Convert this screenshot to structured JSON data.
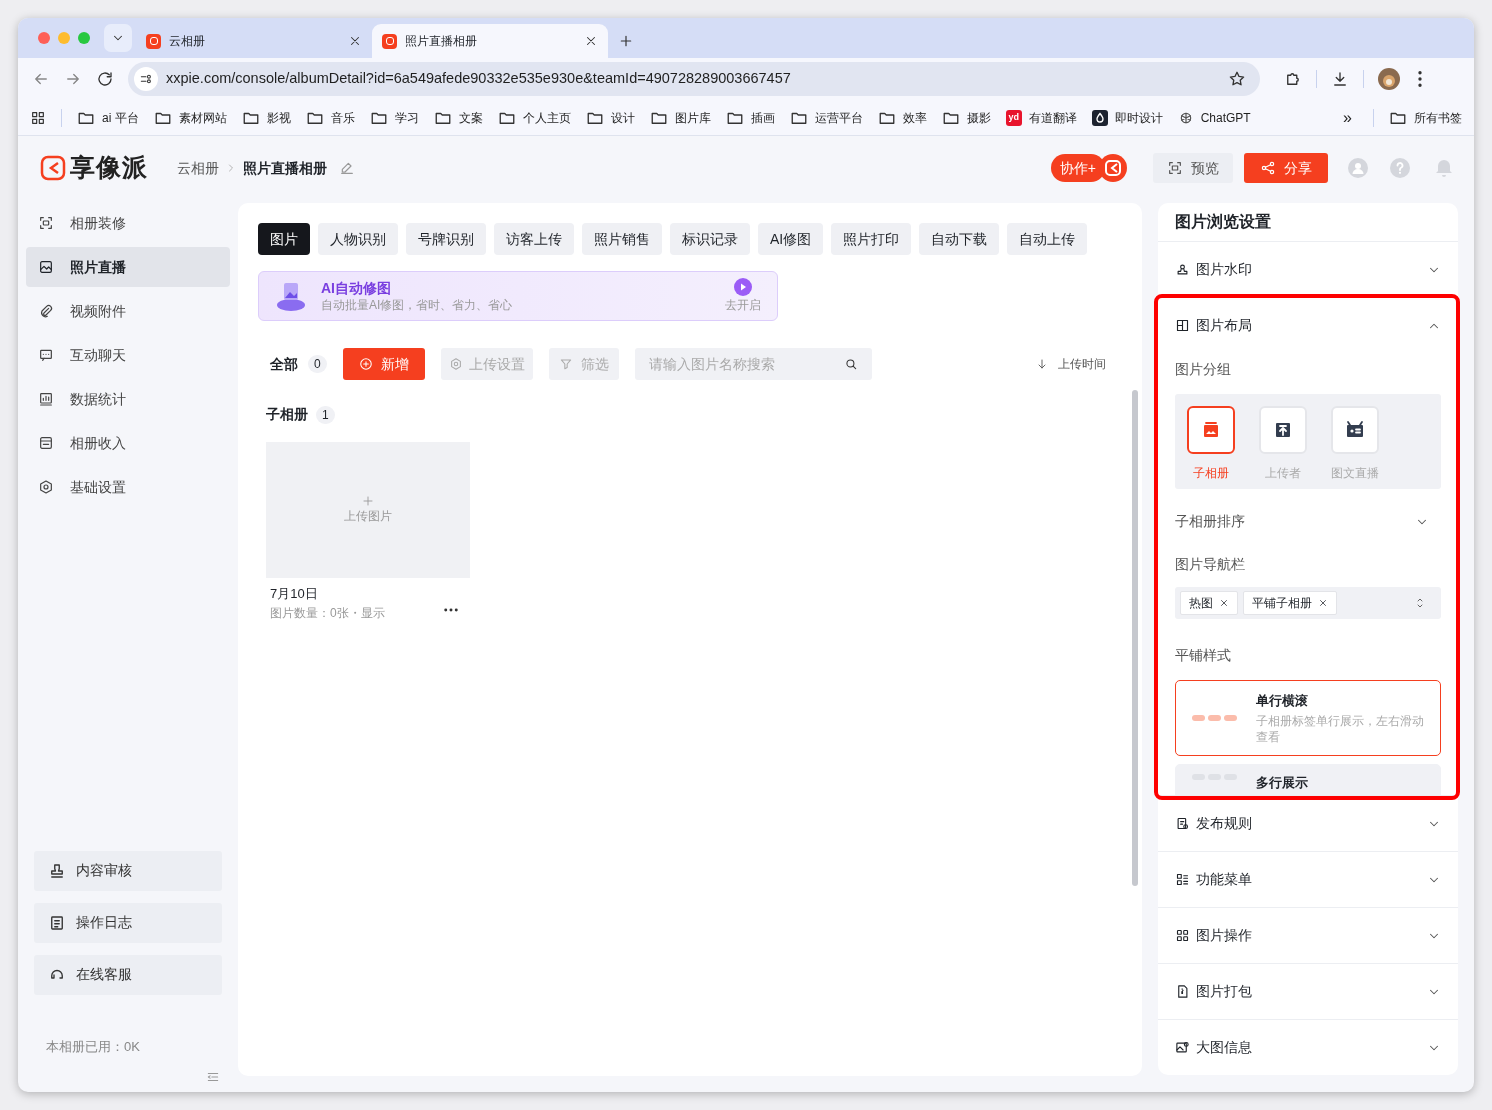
{
  "browser": {
    "tabs": [
      {
        "title": "云相册",
        "selected": false
      },
      {
        "title": "照片直播相册",
        "selected": true
      }
    ],
    "url": "xxpie.com/console/albumDetail?id=6a549afede90332e535e930e&teamId=490728289003667457",
    "bookmarks": [
      {
        "label": "ai 平台",
        "kind": "folder"
      },
      {
        "label": "素材网站",
        "kind": "folder"
      },
      {
        "label": "影视",
        "kind": "folder"
      },
      {
        "label": "音乐",
        "kind": "folder"
      },
      {
        "label": "学习",
        "kind": "folder"
      },
      {
        "label": "文案",
        "kind": "folder"
      },
      {
        "label": "个人主页",
        "kind": "folder"
      },
      {
        "label": "设计",
        "kind": "folder"
      },
      {
        "label": "图片库",
        "kind": "folder"
      },
      {
        "label": "插画",
        "kind": "folder"
      },
      {
        "label": "运营平台",
        "kind": "folder"
      },
      {
        "label": "效率",
        "kind": "folder"
      },
      {
        "label": "摄影",
        "kind": "folder"
      },
      {
        "label": "有道翻译",
        "kind": "badge",
        "badge": "yd"
      },
      {
        "label": "即时设计",
        "kind": "drop"
      },
      {
        "label": "ChatGPT",
        "kind": "knot"
      }
    ],
    "more": "»",
    "all_bookmarks": "所有书签"
  },
  "header": {
    "logo": "享像派",
    "breadcrumb": [
      "云相册",
      "照片直播相册"
    ],
    "collab": "协作+",
    "preview": "预览",
    "share": "分享"
  },
  "sidebar": {
    "items": [
      {
        "label": "相册装修",
        "selected": false
      },
      {
        "label": "照片直播",
        "selected": true
      },
      {
        "label": "视频附件",
        "selected": false
      },
      {
        "label": "互动聊天",
        "selected": false
      },
      {
        "label": "数据统计",
        "selected": false
      },
      {
        "label": "相册收入",
        "selected": false
      },
      {
        "label": "基础设置",
        "selected": false
      }
    ],
    "footer_buttons": [
      "内容审核",
      "操作日志",
      "在线客服"
    ],
    "usage": "本相册已用：0K"
  },
  "main": {
    "tabs": [
      {
        "label": "图片",
        "selected": true
      },
      {
        "label": "人物识别",
        "selected": false
      },
      {
        "label": "号牌识别",
        "selected": false
      },
      {
        "label": "访客上传",
        "selected": false
      },
      {
        "label": "照片销售",
        "selected": false
      },
      {
        "label": "标识记录",
        "selected": false
      },
      {
        "label": "AI修图",
        "selected": false
      },
      {
        "label": "照片打印",
        "selected": false
      },
      {
        "label": "自动下载",
        "selected": false
      },
      {
        "label": "自动上传",
        "selected": false
      }
    ],
    "ai_banner": {
      "title": "AI自动修图",
      "subtitle": "自动批量AI修图，省时、省力、省心",
      "action": "去开启"
    },
    "toolbar": {
      "all": "全部",
      "count": "0",
      "add": "新增",
      "upload_settings": "上传设置",
      "filter": "筛选",
      "search_placeholder": "请输入图片名称搜索",
      "sort": "上传时间"
    },
    "subalbum_heading": "子相册",
    "subalbum_count": "1",
    "albums": [
      {
        "upload_label": "上传图片",
        "name": "7月10日",
        "meta": "图片数量：0张・显示"
      }
    ]
  },
  "settings": {
    "title": "图片浏览设置",
    "sections": [
      {
        "label": "图片水印",
        "expanded": false,
        "highlighted": false
      },
      {
        "label": "图片布局",
        "expanded": true,
        "highlighted": true
      },
      {
        "label": "发布规则",
        "expanded": false,
        "highlighted": false
      },
      {
        "label": "功能菜单",
        "expanded": false,
        "highlighted": false
      },
      {
        "label": "图片操作",
        "expanded": false,
        "highlighted": false
      },
      {
        "label": "图片打包",
        "expanded": false,
        "highlighted": false
      },
      {
        "label": "大图信息",
        "expanded": false,
        "highlighted": false
      }
    ],
    "layout": {
      "grouping_label": "图片分组",
      "grouping": [
        {
          "label": "子相册",
          "selected": true
        },
        {
          "label": "上传者",
          "selected": false
        },
        {
          "label": "图文直播",
          "selected": false
        }
      ],
      "sort_label": "子相册排序",
      "nav_label": "图片导航栏",
      "nav_tags": [
        "热图",
        "平铺子相册"
      ],
      "tile_label": "平铺样式",
      "tile_styles": [
        {
          "title": "单行横滚",
          "desc": "子相册标签单行展示，左右滑动查看",
          "selected": true
        },
        {
          "title": "多行展示",
          "selected": false
        }
      ]
    }
  }
}
